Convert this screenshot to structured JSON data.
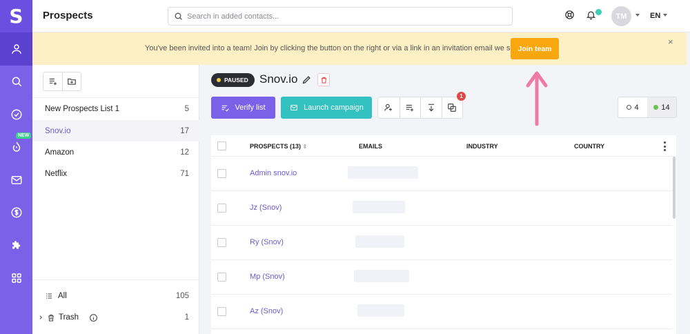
{
  "app": {
    "logo": "S",
    "page_title": "Prospects"
  },
  "nav": {
    "items": [
      {
        "name": "prospects",
        "icon": "person-icon",
        "active": true
      },
      {
        "name": "search",
        "icon": "search-icon"
      },
      {
        "name": "verifier",
        "icon": "check-circle-icon"
      },
      {
        "name": "drips",
        "icon": "drip-icon",
        "badge": "NEW"
      },
      {
        "name": "email",
        "icon": "mail-icon"
      },
      {
        "name": "billing",
        "icon": "dollar-icon"
      },
      {
        "name": "integrations",
        "icon": "puzzle-icon"
      },
      {
        "name": "apps",
        "icon": "grid-icon"
      }
    ]
  },
  "search": {
    "placeholder": "Search in added contacts..."
  },
  "header": {
    "avatar_initials": "TM",
    "language": "EN"
  },
  "banner": {
    "message": "You've been invited into a team! Join by clicking the button on the right or via a link in an invitation email we send you.",
    "join_label": "Join team",
    "close": "×"
  },
  "lists": {
    "items": [
      {
        "name": "New Prospects List 1",
        "count": "5"
      },
      {
        "name": "Snov.io",
        "count": "17",
        "active": true
      },
      {
        "name": "Amazon",
        "count": "12"
      },
      {
        "name": "Netflix",
        "count": "71"
      }
    ],
    "all_label": "All",
    "all_count": "105",
    "trash_label": "Trash",
    "trash_count": "1"
  },
  "list_view": {
    "status": "PAUSED",
    "title": "Snov.io",
    "verify_label": "Verify list",
    "launch_label": "Launch campaign",
    "duplicate_badge": "1",
    "stat_unverified": "4",
    "stat_valid": "14"
  },
  "table": {
    "col_prospects": "PROSPECTS (13)",
    "col_emails": "EMAILS",
    "col_industry": "INDUSTRY",
    "col_country": "COUNTRY",
    "rows": [
      {
        "name": "Admin snov.io"
      },
      {
        "name": "Jz (Snov)"
      },
      {
        "name": "Ry (Snov)"
      },
      {
        "name": "Mp (Snov)"
      },
      {
        "name": "Az (Snov)"
      }
    ]
  },
  "colors": {
    "brand": "#7b61e8",
    "accent_teal": "#34c2c0",
    "join_orange": "#f9a70f",
    "annotation_arrow": "#ee7aa6"
  }
}
